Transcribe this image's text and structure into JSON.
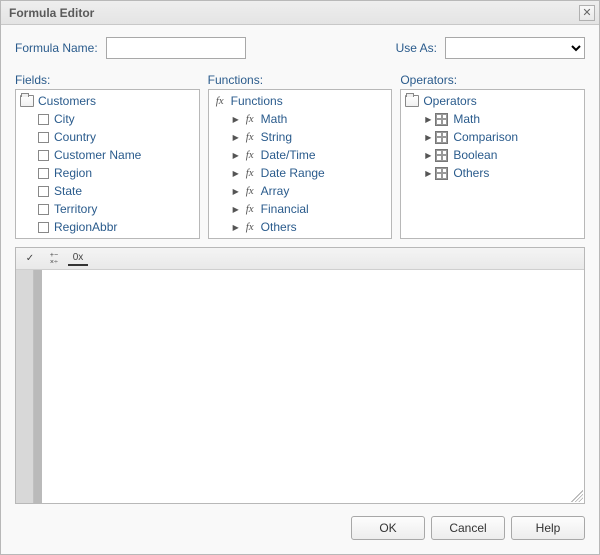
{
  "title": "Formula Editor",
  "top": {
    "formula_name_label": "Formula Name:",
    "formula_name_value": "",
    "use_as_label": "Use As:",
    "use_as_value": ""
  },
  "panels": {
    "fields": {
      "label": "Fields:",
      "root": "Customers",
      "items": [
        "City",
        "Country",
        "Customer Name",
        "Region",
        "State",
        "Territory",
        "RegionAbbr"
      ]
    },
    "functions": {
      "label": "Functions:",
      "root": "Functions",
      "items": [
        "Math",
        "String",
        "Date/Time",
        "Date Range",
        "Array",
        "Financial",
        "Others"
      ]
    },
    "operators": {
      "label": "Operators:",
      "root": "Operators",
      "items": [
        "Math",
        "Comparison",
        "Boolean",
        "Others"
      ]
    }
  },
  "toolbar": {
    "validate": "✓",
    "operators": "+−\n×÷",
    "hex": "0x"
  },
  "editor_value": "",
  "buttons": {
    "ok": "OK",
    "cancel": "Cancel",
    "help": "Help"
  }
}
